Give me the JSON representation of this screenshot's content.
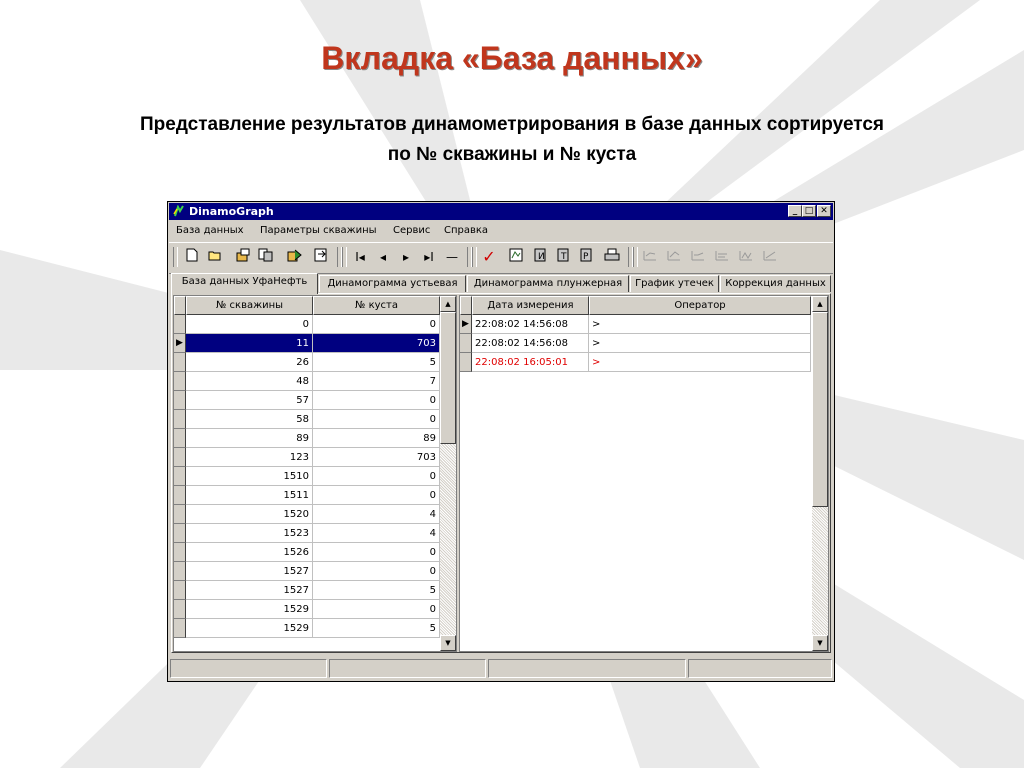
{
  "slide": {
    "title": "Вкладка «База данных»",
    "subtitle_line1": "Представление результатов динамометрирования в базе данных сортируется",
    "subtitle_line2": "по № скважины и № куста",
    "title_color": "#c0361d"
  },
  "window": {
    "title": "DinamoGraph",
    "titlebar_color": "#000080",
    "minimize": "_",
    "maximize": "□",
    "close": "✕"
  },
  "menu": [
    "База данных",
    "Параметры скважины",
    "Сервис",
    "Справка"
  ],
  "toolbar": {
    "nav_first": "I◂",
    "nav_prev": "◂",
    "nav_next": "▸",
    "nav_last": "▸I",
    "nav_delete": "—",
    "check": "✓"
  },
  "tabs": [
    "База данных УфаНефть",
    "Динамограмма устьевая",
    "Динамограмма плунжерная",
    "График утечек",
    "Коррекция данных"
  ],
  "wells_grid": {
    "headers": [
      "№ скважины",
      "№ куста"
    ],
    "rows": [
      {
        "well": "0",
        "cluster": "0"
      },
      {
        "well": "11",
        "cluster": "703"
      },
      {
        "well": "26",
        "cluster": "5"
      },
      {
        "well": "48",
        "cluster": "7"
      },
      {
        "well": "57",
        "cluster": "0"
      },
      {
        "well": "58",
        "cluster": "0"
      },
      {
        "well": "89",
        "cluster": "89"
      },
      {
        "well": "123",
        "cluster": "703"
      },
      {
        "well": "1510",
        "cluster": "0"
      },
      {
        "well": "1511",
        "cluster": "0"
      },
      {
        "well": "1520",
        "cluster": "4"
      },
      {
        "well": "1523",
        "cluster": "4"
      },
      {
        "well": "1526",
        "cluster": "0"
      },
      {
        "well": "1527",
        "cluster": "0"
      },
      {
        "well": "1527",
        "cluster": "5"
      },
      {
        "well": "1529",
        "cluster": "0"
      },
      {
        "well": "1529",
        "cluster": "5"
      }
    ],
    "selected_row": 1,
    "selection_color": "#000080"
  },
  "measurements_grid": {
    "headers": [
      "Дата измерения",
      "Оператор"
    ],
    "rows": [
      {
        "date": "22:08:02 14:56:08",
        "operator": ">",
        "color": "#000000"
      },
      {
        "date": "22:08:02 14:56:08",
        "operator": ">",
        "color": "#000000"
      },
      {
        "date": "22:08:02 16:05:01",
        "operator": ">",
        "color": "#e00000"
      }
    ]
  },
  "scroll": {
    "up": "▲",
    "down": "▼"
  }
}
